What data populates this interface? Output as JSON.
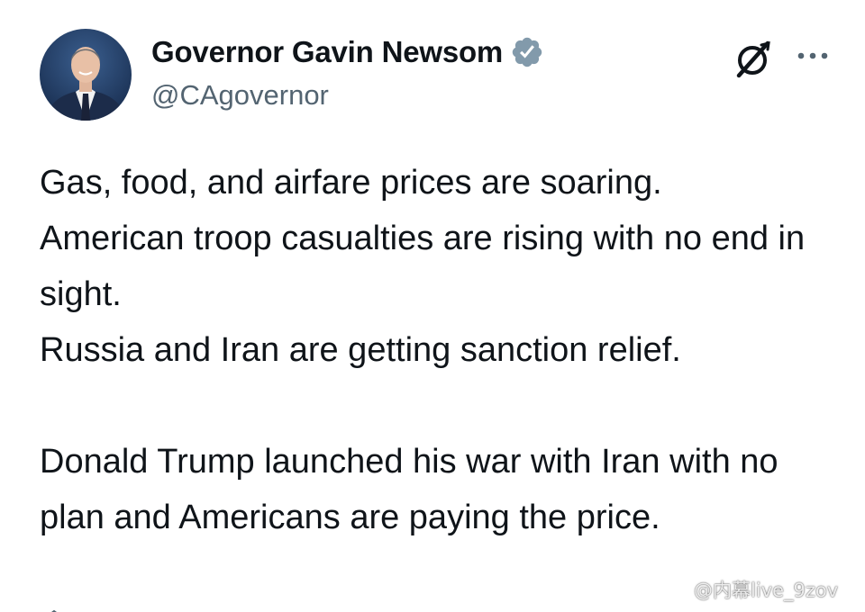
{
  "author": {
    "display_name": "Governor Gavin Newsom",
    "handle": "@CAgovernor",
    "verified": true,
    "verified_badge_color": "#829aab"
  },
  "header_actions": {
    "grok_icon": "grok-icon",
    "more_icon": "more-horizontal-icon"
  },
  "tweet": {
    "lines": [
      "Gas, food, and airfare prices are soaring.",
      "American troop casualties are rising with no end in sight.",
      "Russia and Iran are getting sanction relief.",
      "",
      "Donald Trump launched his war with Iran with no plan and Americans are paying the price."
    ]
  },
  "watermark": {
    "text": "@内幕live_9zov",
    "icon": "weibo-logo"
  },
  "colors": {
    "text_primary": "#0f1419",
    "text_secondary": "#536471",
    "link_blue": "#1d9bf0"
  }
}
